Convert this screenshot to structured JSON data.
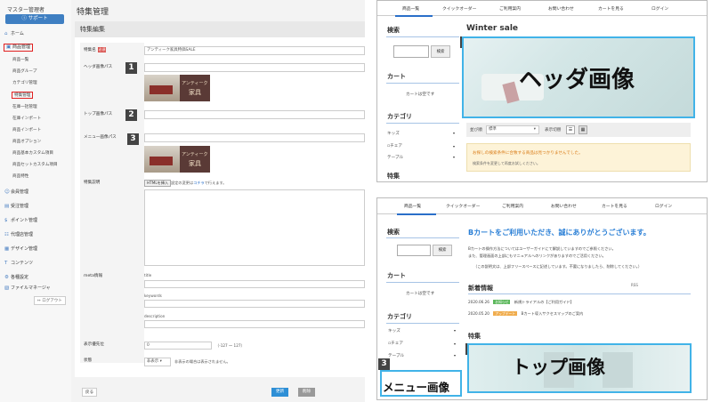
{
  "admin": {
    "user": "マスター管理者",
    "support": "サポート",
    "logout": "ログアウト",
    "menu": [
      {
        "icon": "⌂",
        "label": "ホーム",
        "name": "home"
      },
      {
        "icon": "▣",
        "label": "商品管理",
        "name": "product-management"
      }
    ],
    "product_sub": [
      "商品一覧",
      "商品グループ",
      "カテゴリ管理",
      "特集管理",
      "在庫一括管理",
      "在庫インポート",
      "商品インポート",
      "商品オプション",
      "商品基本カスタム項目",
      "商品セットカスタム項目",
      "商品特性"
    ],
    "menu2": [
      {
        "icon": "☺",
        "label": "会員管理",
        "name": "member-management"
      },
      {
        "icon": "▤",
        "label": "受注管理",
        "name": "order-management"
      },
      {
        "icon": "$",
        "label": "ポイント管理",
        "name": "point-management"
      },
      {
        "icon": "☷",
        "label": "代理店管理",
        "name": "agency-management"
      },
      {
        "icon": "▦",
        "label": "デザイン管理",
        "name": "design-management"
      },
      {
        "icon": "T",
        "label": "コンテンツ",
        "name": "contents"
      },
      {
        "icon": "⚙",
        "label": "各種設定",
        "name": "settings"
      },
      {
        "icon": "▧",
        "label": "ファイルマネージャ",
        "name": "file-manager"
      }
    ],
    "page_title": "特集管理",
    "section_title": "特集編集",
    "fields": {
      "name_label": "特集名",
      "required": "必須",
      "name_value": "アンティーク家具特価SALE",
      "header_label": "ヘッダ画像パス",
      "top_label": "トップ画像パス",
      "menu_label": "メニュー画像パス",
      "desc_label": "特集説明",
      "desc_btn": "HTMLを挿入",
      "desc_note_pre": "設定の変更は",
      "desc_note_link": "コチラ",
      "desc_note_post": "で行えます。",
      "meta_label": "meta情報",
      "meta_title": "title",
      "meta_keywords": "keywords",
      "meta_description": "description",
      "order_label": "表示優先位",
      "order_value": "0",
      "order_range": "（-127 ～ 127）",
      "status_label": "状態",
      "status_value": "非表示",
      "status_note": "非表示の場合は表示されません。"
    },
    "thumb_text1": "アンティーク",
    "thumb_text2": "家具",
    "back": "戻る",
    "update": "更新",
    "delete": "削除"
  },
  "badges": [
    "1",
    "2",
    "3"
  ],
  "preview": {
    "nav": [
      "商品一覧",
      "クイックオーダー",
      "ご利用案内",
      "お問い合わせ",
      "カートを見る",
      "ログイン"
    ],
    "search_h": "検索",
    "search_btn": "検索",
    "cart_h": "カート",
    "cart_empty": "カートは空です",
    "category_h": "カテゴリ",
    "cat_items": [
      "キッズ",
      "チェア",
      "テーブル"
    ],
    "feature_h": "特集",
    "winter": "Winter sale",
    "header_img": "ヘッダ画像",
    "sort_label": "並び順",
    "sort_value": "標準",
    "view_label": "表示切替",
    "notice1": "お探しの検索条件に合致する商品は見つかりませんでした。",
    "notice2": "検索条件を変更して再度お試しください。",
    "welcome": "Bカートをご利用いただき、誠にありがとうございます。",
    "intro1": "Bカートの操作方法についてはユーザーガイドにて解説していますのでご参照ください。",
    "intro2": "また、管理画面の上部にもマニュアルへのリンクがありますのでご活用ください。",
    "intro3": "（この説明文は、上部フリースペースに記述しています。不要になりましたら、削除してください。）",
    "news_h": "新着情報",
    "news": [
      {
        "date": "2020.06.26",
        "tag": "お知らせ",
        "tagcolor": "#5cb85c",
        "text": "新規トライアルの【ご利用ガイド】"
      },
      {
        "date": "2020.05.20",
        "tag": "アップデート",
        "tagcolor": "#f0ad4e",
        "text": "Bカート導入サクセスマップのご案内"
      }
    ],
    "top_img": "トップ画像",
    "menu_img": "メニュー画像"
  }
}
